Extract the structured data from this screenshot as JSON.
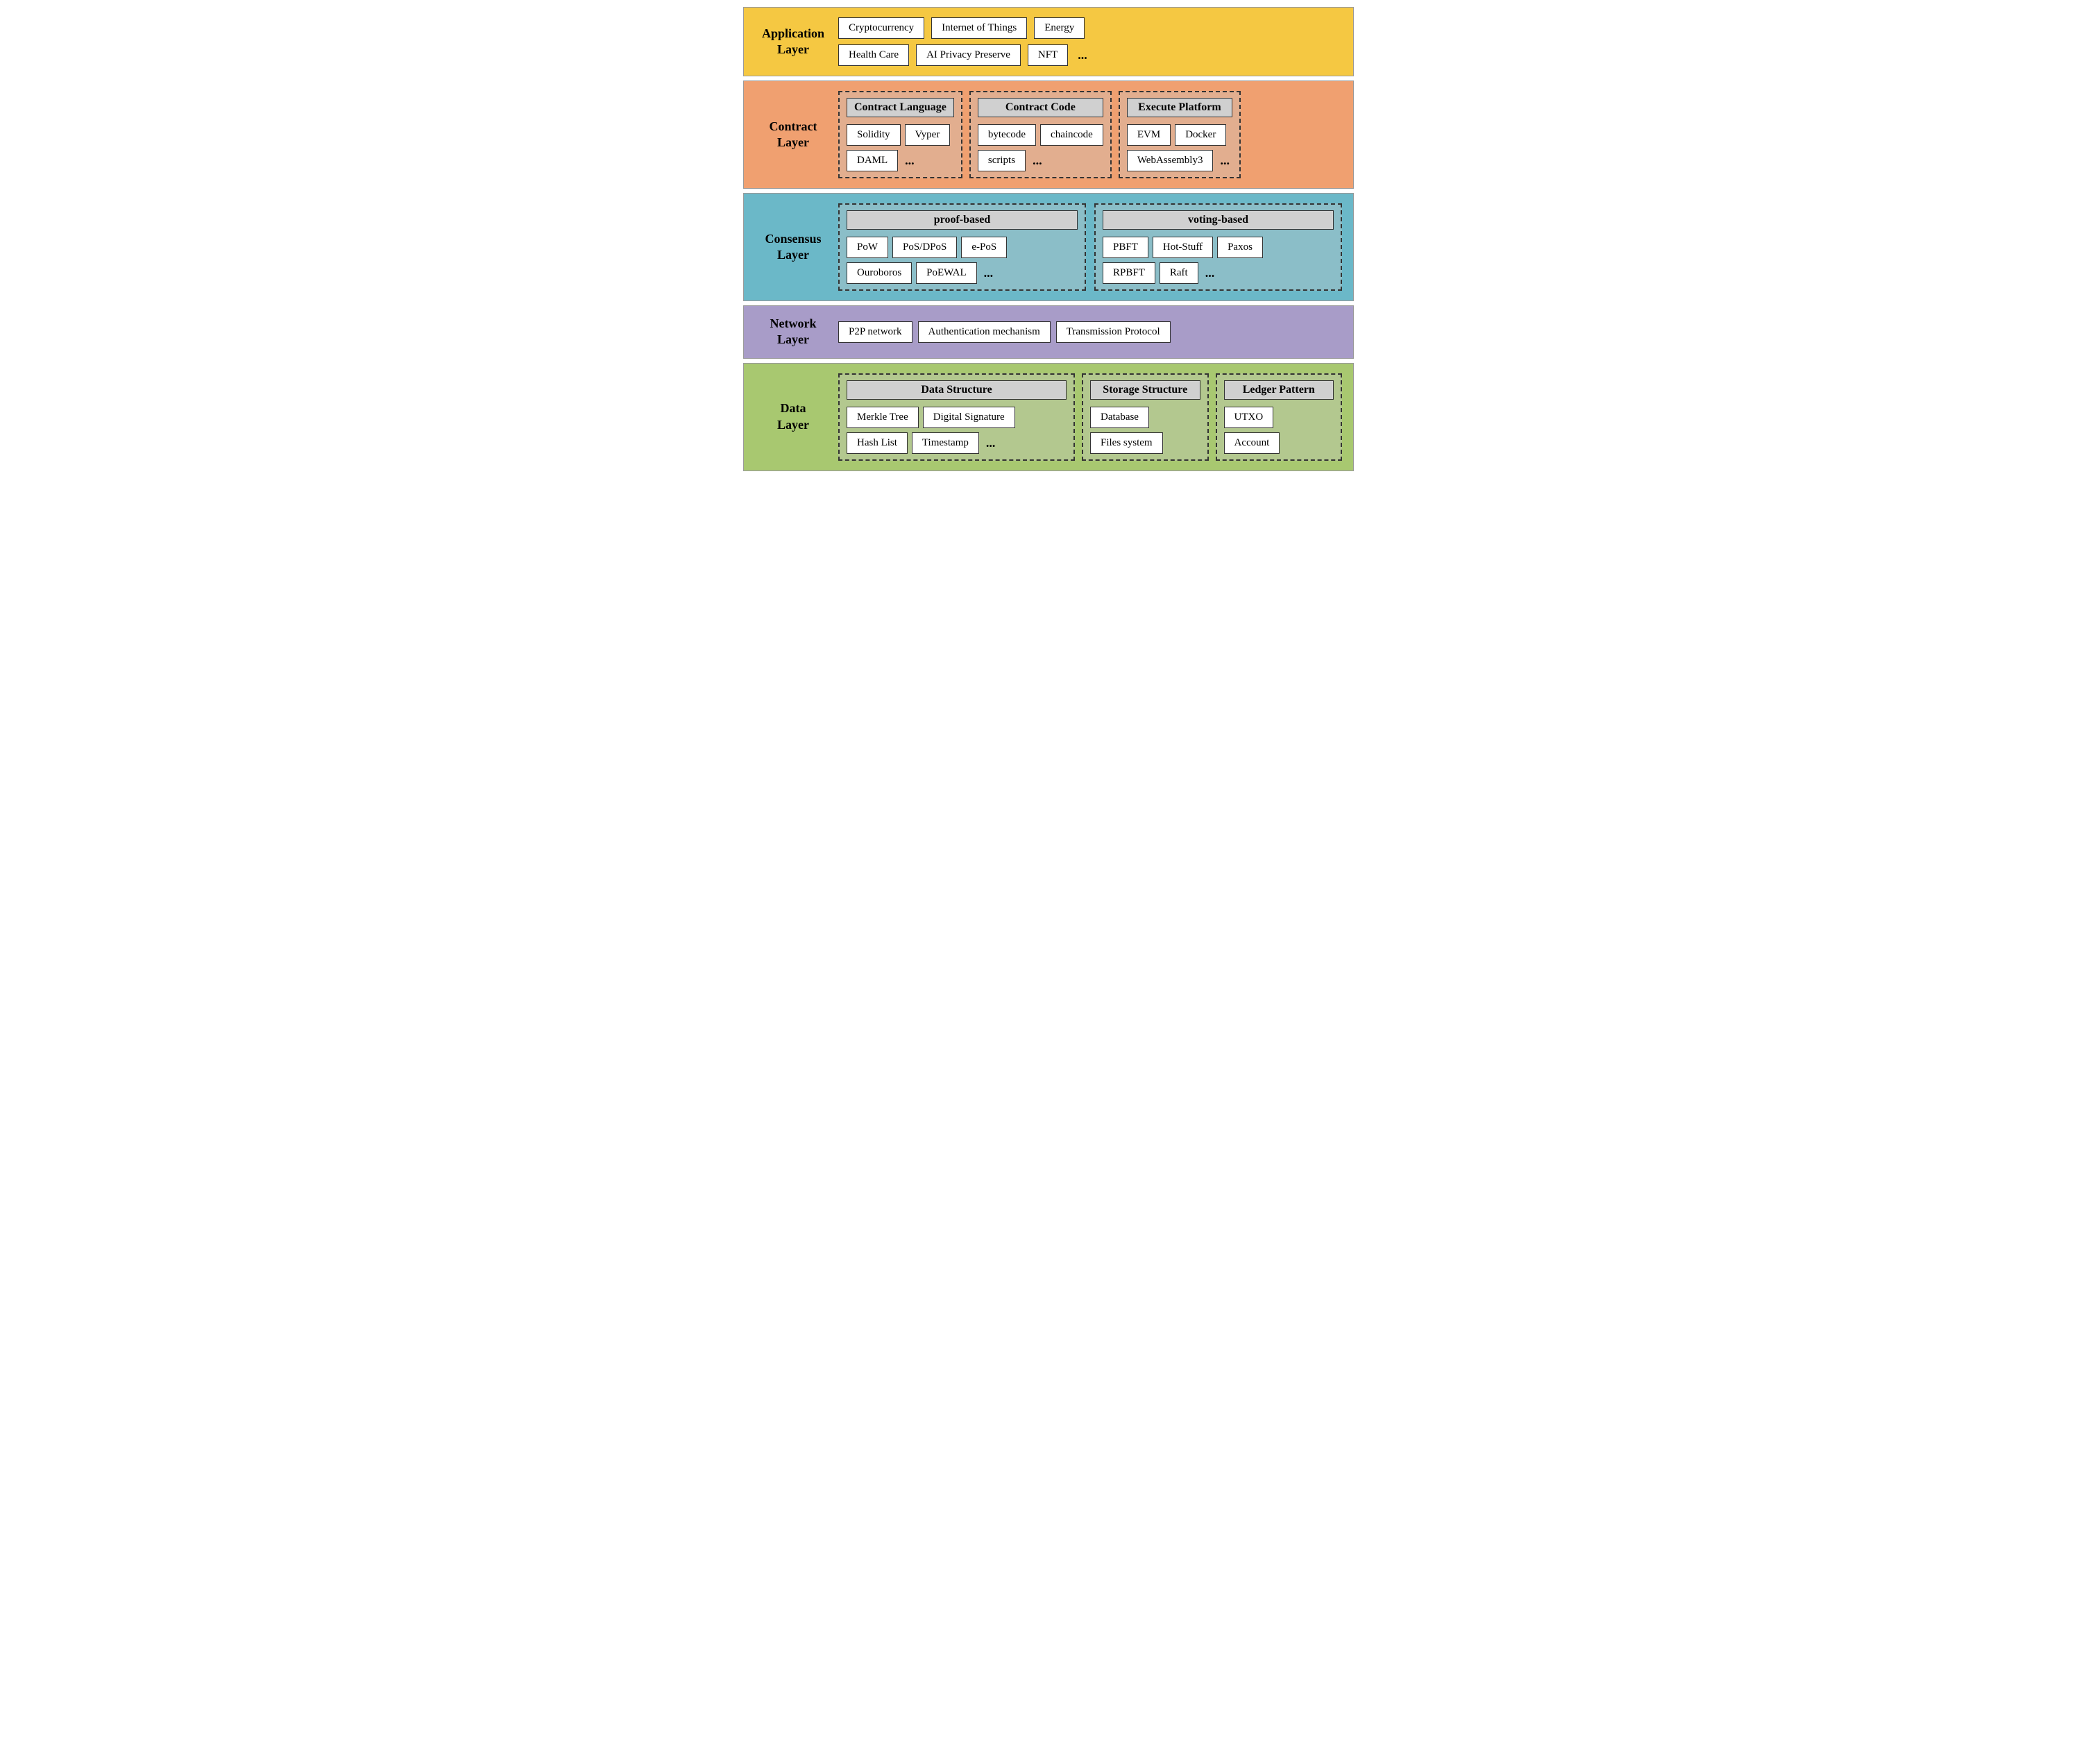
{
  "layers": {
    "application": {
      "label": "Application\nLayer",
      "color": "#F5C842",
      "items_row1": [
        "Cryptocurrency",
        "Internet of Things",
        "Energy"
      ],
      "items_row2": [
        "Health Care",
        "AI Privacy Preserve",
        "NFT",
        "..."
      ]
    },
    "contract": {
      "label": "Contract\nLayer",
      "color": "#F0A070",
      "groups": [
        {
          "title": "Contract Language",
          "row1": [
            "Solidity",
            "Vyper"
          ],
          "row2": [
            "DAML",
            "..."
          ]
        },
        {
          "title": "Contract Code",
          "row1": [
            "bytecode",
            "chaincode"
          ],
          "row2": [
            "scripts",
            "..."
          ]
        },
        {
          "title": "Execute Platform",
          "row1": [
            "EVM",
            "Docker"
          ],
          "row2": [
            "WebAssembly3",
            "..."
          ]
        }
      ]
    },
    "consensus": {
      "label": "Consensus\nLayer",
      "color": "#6BB8C8",
      "groups": [
        {
          "title": "proof-based",
          "row1": [
            "PoW",
            "PoS/DPoS",
            "e-PoS"
          ],
          "row2": [
            "Ouroboros",
            "PoEWAL",
            "..."
          ]
        },
        {
          "title": "voting-based",
          "row1": [
            "PBFT",
            "Hot-Stuff",
            "Paxos"
          ],
          "row2": [
            "RPBFT",
            "Raft",
            "..."
          ]
        }
      ]
    },
    "network": {
      "label": "Network\nLayer",
      "color": "#A89CC8",
      "items": [
        "P2P network",
        "Authentication mechanism",
        "Transmission Protocol"
      ]
    },
    "data": {
      "label": "Data\nLayer",
      "color": "#A8C870",
      "groups": [
        {
          "title": "Data Structure",
          "row1": [
            "Merkle Tree",
            "Digital Signature"
          ],
          "row2": [
            "Hash List",
            "Timestamp",
            "..."
          ]
        },
        {
          "title": "Storage Structure",
          "rows": [
            [
              "Database"
            ],
            [
              "Files system"
            ]
          ]
        },
        {
          "title": "Ledger Pattern",
          "rows": [
            [
              "UTXO"
            ],
            [
              "Account"
            ]
          ]
        }
      ]
    }
  }
}
